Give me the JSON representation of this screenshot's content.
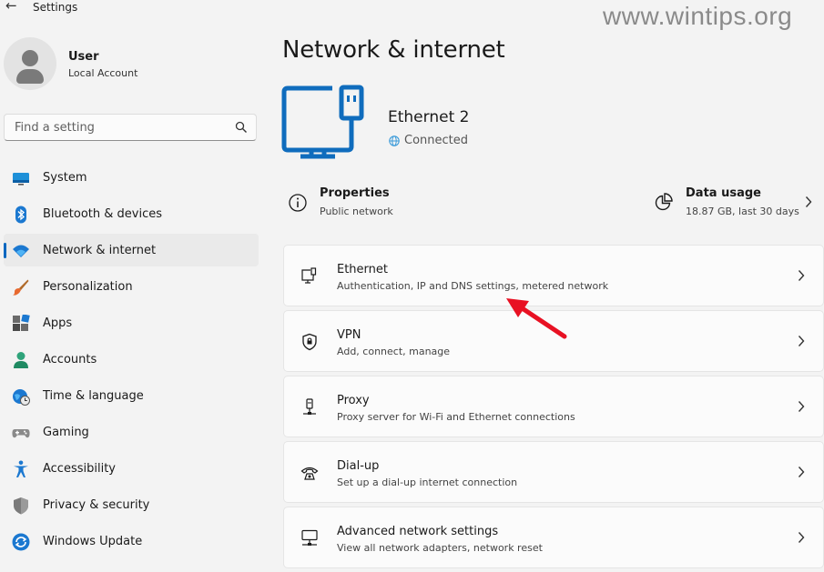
{
  "window": {
    "title": "Settings",
    "watermark": "www.wintips.org"
  },
  "user": {
    "name": "User",
    "account": "Local Account"
  },
  "search": {
    "placeholder": "Find a setting"
  },
  "sidebar": {
    "items": [
      {
        "label": "System",
        "icon": "monitor-icon"
      },
      {
        "label": "Bluetooth & devices",
        "icon": "bluetooth-icon"
      },
      {
        "label": "Network & internet",
        "icon": "wifi-icon",
        "active": true
      },
      {
        "label": "Personalization",
        "icon": "brush-icon"
      },
      {
        "label": "Apps",
        "icon": "apps-icon"
      },
      {
        "label": "Accounts",
        "icon": "person-icon"
      },
      {
        "label": "Time & language",
        "icon": "clock-globe-icon"
      },
      {
        "label": "Gaming",
        "icon": "gamepad-icon"
      },
      {
        "label": "Accessibility",
        "icon": "accessibility-icon"
      },
      {
        "label": "Privacy & security",
        "icon": "shield-icon"
      },
      {
        "label": "Windows Update",
        "icon": "update-icon"
      }
    ]
  },
  "main": {
    "title": "Network & internet",
    "connection": {
      "name": "Ethernet 2",
      "status": "Connected"
    },
    "properties": {
      "title": "Properties",
      "subtitle": "Public network"
    },
    "data_usage": {
      "title": "Data usage",
      "subtitle": "18.87 GB, last 30 days"
    },
    "cards": [
      {
        "title": "Ethernet",
        "subtitle": "Authentication, IP and DNS settings, metered network",
        "icon": "ethernet-icon"
      },
      {
        "title": "VPN",
        "subtitle": "Add, connect, manage",
        "icon": "vpn-shield-icon"
      },
      {
        "title": "Proxy",
        "subtitle": "Proxy server for Wi-Fi and Ethernet connections",
        "icon": "proxy-icon"
      },
      {
        "title": "Dial-up",
        "subtitle": "Set up a dial-up internet connection",
        "icon": "dialup-phone-icon"
      },
      {
        "title": "Advanced network settings",
        "subtitle": "View all network adapters, network reset",
        "icon": "network-adapter-icon"
      }
    ]
  },
  "colors": {
    "accent": "#0067c0",
    "hero": "#0f6cbd",
    "annotation_arrow": "#e81123"
  }
}
